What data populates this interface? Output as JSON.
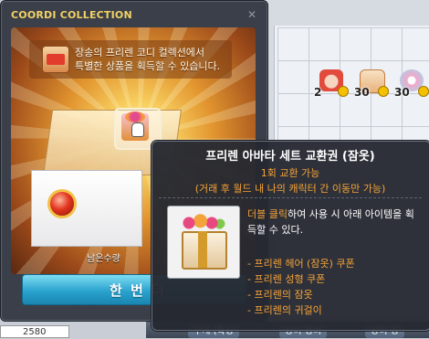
{
  "window": {
    "title": "COORDI COLLECTION",
    "close_icon": "close-icon"
  },
  "banner": {
    "line1": "장송의 프리렌 코디 컬렉션에서",
    "line2": "특별한 상품을 획득할 수 있습니다."
  },
  "panel": {
    "remaining_label": "남은수량",
    "once_button_label": "한 번 더"
  },
  "tooltip": {
    "title": "프리렌 아바타 세트 교환권 (잠옷)",
    "exchange_limit": "1회 교환 가능",
    "transfer_note": "(거래 후 월드 내 나의 캐릭터 간 이동만 가능)",
    "desc_highlight": "더블 클릭",
    "desc_rest": "하여 사용 시 아래 아이템을 획득할 수 있다.",
    "items": [
      "- 프리렌 헤어 (잠옷) 쿠폰",
      "- 프리렌 성형 쿠폰",
      "- 프리렌의 잠옷",
      "- 프리렌의 귀걸이"
    ]
  },
  "inventory": {
    "slots": [
      {
        "count": "2",
        "color": "#e24b3c"
      },
      {
        "count": "30",
        "color": "#f3c7a0"
      },
      {
        "count": "30",
        "color": "#f2a9c9"
      }
    ],
    "bottom_buttons": [
      "부캐 (확성",
      "장비 정비",
      "장비 정"
    ],
    "amount_value": "2580"
  },
  "colors": {
    "title_gold": "#f1d264",
    "tooltip_orange": "#f7a338",
    "button_blue": "#2aa3cf"
  }
}
